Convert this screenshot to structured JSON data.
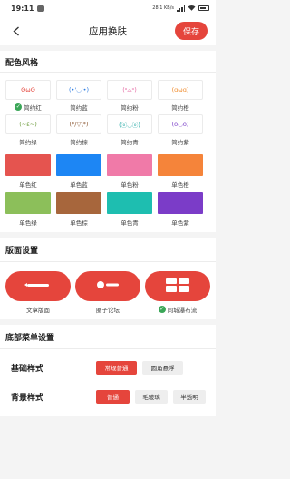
{
  "status": {
    "time": "19:11",
    "net": "28.1 KB/s",
    "battery": "5G"
  },
  "nav": {
    "title": "应用换肤",
    "save_label": "保存"
  },
  "color_style": {
    "title": "配色风格",
    "themes": [
      {
        "face": "ʘωʘ",
        "label": "简约红",
        "color": "#e5453c",
        "selected": true
      },
      {
        "face": "(•'◡'•)",
        "label": "简约蓝",
        "color": "#2f7de1",
        "selected": false
      },
      {
        "face": "(ᵒ⌓ᵒ)",
        "label": "简约粉",
        "color": "#e56aa3",
        "selected": false
      },
      {
        "face": "(ɑωɑ)",
        "label": "简约橙",
        "color": "#f08a2a",
        "selected": false
      },
      {
        "face": "(~ε~)",
        "label": "简约绿",
        "color": "#6b9a3a",
        "selected": false
      },
      {
        "face": "(*/▽\\*)",
        "label": "简约棕",
        "color": "#8d5a36",
        "selected": false
      },
      {
        "face": "(ⓞ◡ⓞ)",
        "label": "简约青",
        "color": "#1aa5a0",
        "selected": false
      },
      {
        "face": "(ŏ◡ŏ)",
        "label": "简约紫",
        "color": "#7a3ec8",
        "selected": false
      }
    ],
    "solids": [
      {
        "label": "单色红",
        "color": "#e5544f"
      },
      {
        "label": "单色蓝",
        "color": "#1d86f4"
      },
      {
        "label": "单色粉",
        "color": "#f07aa8"
      },
      {
        "label": "单色橙",
        "color": "#f5843a"
      },
      {
        "label": "单色绿",
        "color": "#8cbf5a"
      },
      {
        "label": "单色棕",
        "color": "#a7663c"
      },
      {
        "label": "单色青",
        "color": "#1ebeb0"
      },
      {
        "label": "单色紫",
        "color": "#7b3cc8"
      }
    ]
  },
  "layout": {
    "title": "版面设置",
    "options": [
      {
        "label": "文章版面",
        "icon": "article-layout-icon",
        "selected": false
      },
      {
        "label": "圈子论坛",
        "icon": "forum-layout-icon",
        "selected": false
      },
      {
        "label": "同城瀑布流",
        "icon": "waterfall-layout-icon",
        "selected": true
      }
    ]
  },
  "bottom_menu": {
    "title": "底部菜单设置",
    "basic": {
      "label": "基础样式",
      "options": [
        "常规普通",
        "圆角悬浮"
      ],
      "active": 0
    },
    "background": {
      "label": "背景样式",
      "options": [
        "普通",
        "毛玻璃",
        "半透明"
      ],
      "active": 0
    }
  },
  "accent_color": "#e5453c"
}
